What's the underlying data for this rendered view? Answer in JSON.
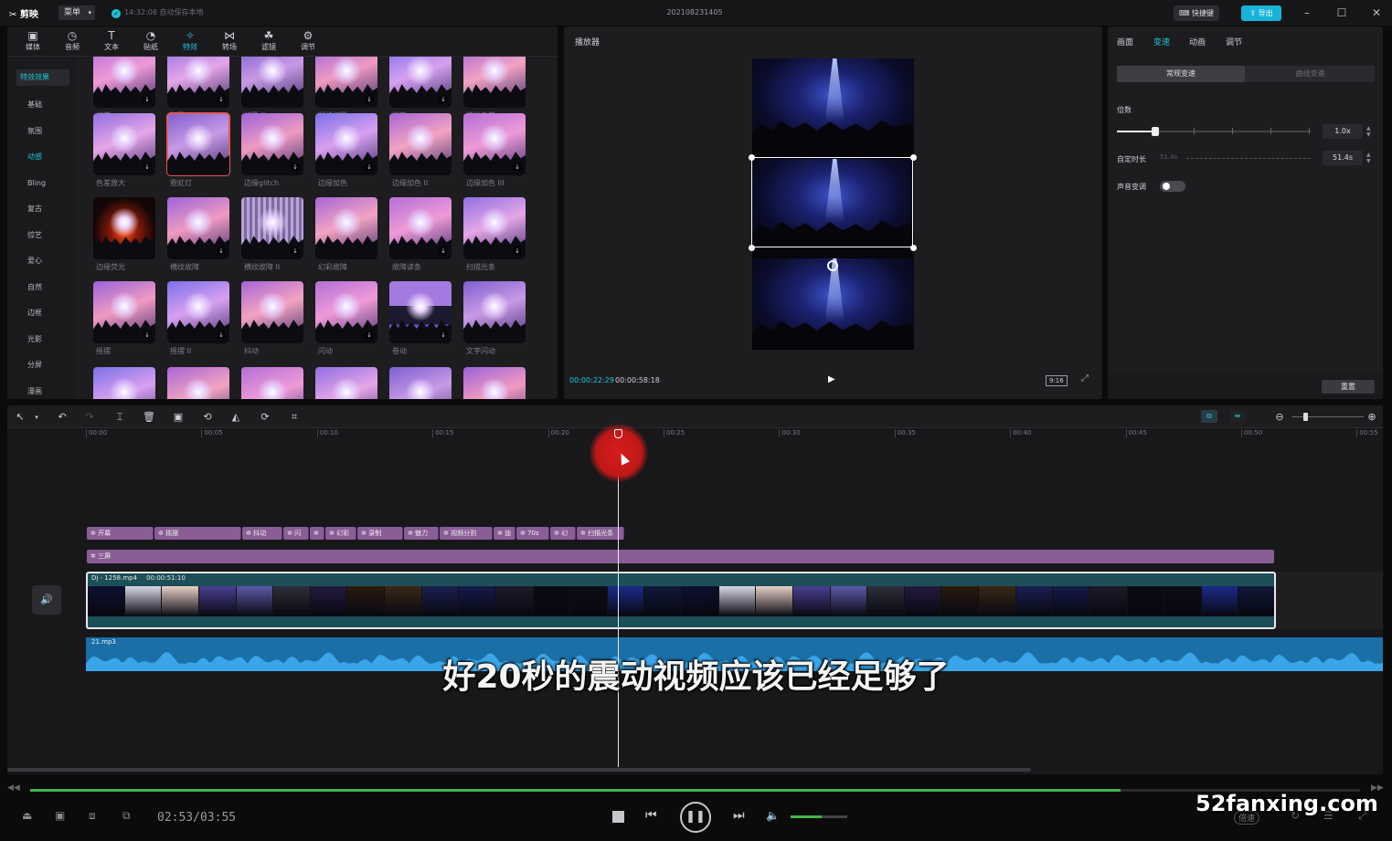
{
  "titlebar": {
    "app_name": "剪映",
    "menu_label": "菜单",
    "save_status": "14:32:06 自动保存本地",
    "project_title": "202108231405",
    "shortcut_label": "快捷键",
    "export_label": "导出"
  },
  "media_tabs": [
    {
      "label": "媒体",
      "icon": "media-icon"
    },
    {
      "label": "音频",
      "icon": "audio-icon"
    },
    {
      "label": "文本",
      "icon": "text-icon"
    },
    {
      "label": "贴纸",
      "icon": "sticker-icon"
    },
    {
      "label": "特效",
      "icon": "effects-icon",
      "active": true
    },
    {
      "label": "转场",
      "icon": "transition-icon"
    },
    {
      "label": "滤镜",
      "icon": "filter-icon"
    },
    {
      "label": "调节",
      "icon": "adjust-icon"
    }
  ],
  "categories": {
    "header": "特效效果",
    "items": [
      "基础",
      "氛围",
      "动感",
      "Bling",
      "复古",
      "综艺",
      "爱心",
      "自然",
      "边框",
      "光影",
      "分屏",
      "漫画"
    ],
    "active": "动感"
  },
  "effects": [
    [
      "幻觉",
      "幻影",
      "幻影 II",
      "彩虹幻影",
      "迷离",
      "波纹色差"
    ],
    [
      "色差放大",
      "霓虹灯",
      "边缘glitch",
      "边缘加色",
      "边缘加色 II",
      "边缘加色 III"
    ],
    [
      "边缘荧光",
      "横纹故障",
      "横纹故障 II",
      "幻彩故障",
      "故障读条",
      "扫描光条"
    ],
    [
      "摇摆",
      "摇摆 II",
      "抖动",
      "闪动",
      "卷动",
      "文字闪动"
    ]
  ],
  "player": {
    "title": "播放器",
    "current_time": "00:00:22:29",
    "duration": "00:00:58:18",
    "ratio": "9:16"
  },
  "properties": {
    "tabs": [
      "画面",
      "变速",
      "动画",
      "调节"
    ],
    "active_tab": "变速",
    "speed_modes": [
      "常规变速",
      "曲线变速"
    ],
    "multiplier_label": "倍数",
    "multiplier_value": "1.0x",
    "multiplier_position": 0.2,
    "duration_label": "自定时长",
    "duration_hint": "51.4s",
    "duration_value": "51.4s",
    "pitch_label": "声音变调",
    "reset_label": "重置"
  },
  "timeline": {
    "ruler": [
      "00:00",
      "00:05",
      "00:10",
      "00:15",
      "00:20",
      "00:25",
      "00:30",
      "00:35",
      "00:40",
      "00:45",
      "00:50",
      "00:55"
    ],
    "effect_clips": [
      "开幕",
      "摇摆",
      "抖动",
      "闪",
      "",
      "幻彩",
      "录制",
      "魅力",
      "视频分割",
      "迪",
      "70s",
      "幻",
      "扫描光条"
    ],
    "effect_clip2": "三屏",
    "video_clip_name": "Dj - 1258.mp4",
    "video_clip_duration": "00:00:51:10",
    "audio_clip_name": "21.mp3"
  },
  "subtitle": "好20秒的震动视频应该已经足够了",
  "bottom": {
    "time": "02:53/03:55",
    "progress": 0.82,
    "volume": 0.55,
    "speed_label": "倍速"
  },
  "watermark": "52fanxing.com"
}
